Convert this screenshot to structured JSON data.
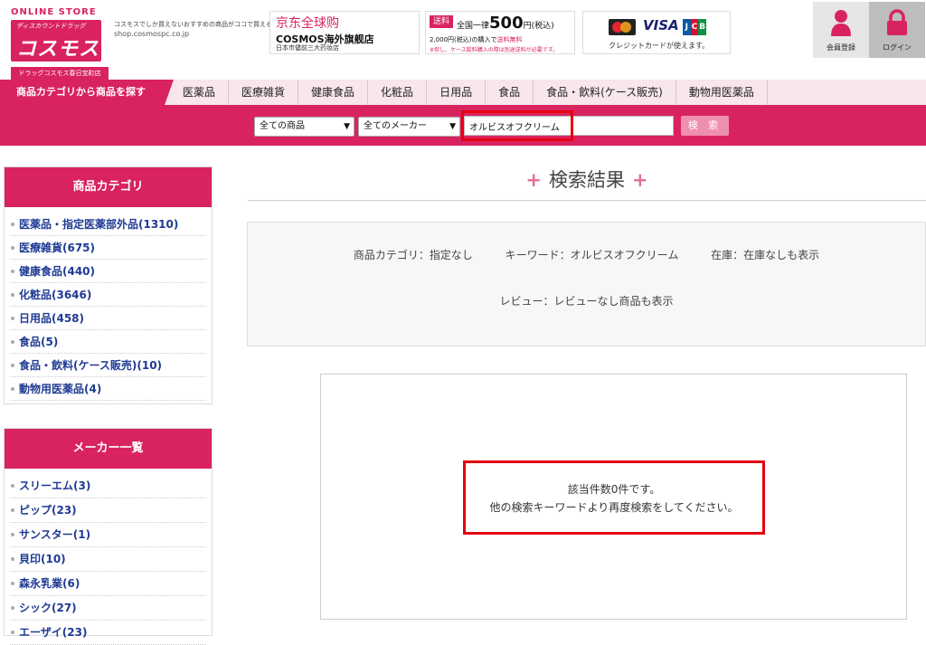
{
  "header": {
    "logo": {
      "online_store": "ONLINE STORE",
      "subtitle": "ディスカウントドラッグ",
      "name": "コスモス",
      "store_label": "ドラッグコスモス春日宝町店"
    },
    "tagline": "コスモスでしか買えないおすすめの商品がココで買える!",
    "url": "shop.cosmospc.co.jp",
    "jd_banner": {
      "title": "京东全球购",
      "name": "COSMOS海外旗舰店",
      "address": "日本市儘前三大药妆店"
    },
    "shipping_banner": {
      "tag": "送料",
      "prefix": "全国一律",
      "amount": "500",
      "suffix": "円(税込)",
      "note_prefix": "2,000円(税込)の購入で",
      "note_free": "送料無料",
      "note2": "※但し、ケース飲料購入の際は別途送料が必要です。"
    },
    "card_banner": {
      "visa": "VISA",
      "jcb": [
        "J",
        "C",
        "B"
      ],
      "text": "クレジットカードが使えます。"
    },
    "register_label": "会員登録",
    "login_label": "ログイン"
  },
  "nav": {
    "main": "商品カテゴリから商品を探す",
    "items": [
      "医薬品",
      "医療雑貨",
      "健康食品",
      "化粧品",
      "日用品",
      "食品",
      "食品・飲料(ケース販売)",
      "動物用医薬品"
    ]
  },
  "search": {
    "category_select": "全ての商品",
    "maker_select": "全てのメーカー",
    "keyword": "オルビスオフクリーム",
    "button": "検 索"
  },
  "sidebar": {
    "categories_title": "商品カテゴリ",
    "categories": [
      "医薬品・指定医薬部外品(1310)",
      "医療雑貨(675)",
      "健康食品(440)",
      "化粧品(3646)",
      "日用品(458)",
      "食品(5)",
      "食品・飲料(ケース販売)(10)",
      "動物用医薬品(4)"
    ],
    "makers_title": "メーカー一覧",
    "makers": [
      "スリーエム(3)",
      "ピップ(23)",
      "サンスター(1)",
      "貝印(10)",
      "森永乳業(6)",
      "シック(27)",
      "エーザイ(23)"
    ]
  },
  "main": {
    "title": "検索結果",
    "conditions": {
      "category": "商品カテゴリ：指定なし",
      "keyword": "キーワード：オルビスオフクリーム",
      "stock": "在庫：在庫なしも表示",
      "review": "レビュー：レビューなし商品も表示"
    },
    "empty_line1": "該当件数0件です。",
    "empty_line2": "他の検索キーワードより再度検索をしてください。"
  },
  "colors": {
    "brand": "#d9235f",
    "highlight": "#e60012",
    "link": "#1f3a93"
  }
}
